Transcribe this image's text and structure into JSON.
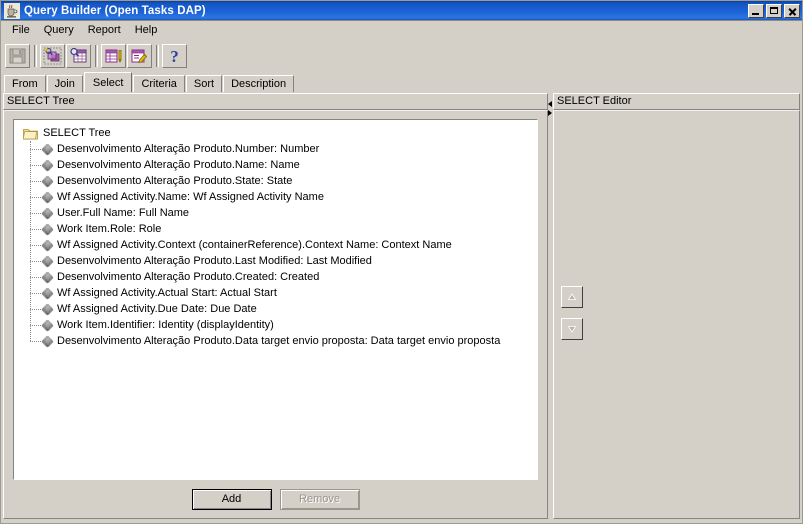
{
  "window": {
    "title": "Query Builder (Open Tasks DAP)",
    "app_icon": "java-coffee-cup-icon",
    "controls": {
      "minimize": "minimize-button",
      "maximize": "maximize-button",
      "close": "close-button"
    }
  },
  "menubar": {
    "items": [
      {
        "label": "File"
      },
      {
        "label": "Query"
      },
      {
        "label": "Report"
      },
      {
        "label": "Help"
      }
    ]
  },
  "toolbar": {
    "buttons": [
      {
        "icon": "save-icon",
        "tooltip": "Save",
        "enabled": false
      },
      {
        "icon": "new-query-icon",
        "tooltip": "New Query",
        "enabled": true
      },
      {
        "icon": "find-table-icon",
        "tooltip": "Find Table",
        "enabled": true
      },
      {
        "icon": "edit-report-icon",
        "tooltip": "Edit Report",
        "enabled": true
      },
      {
        "icon": "edit-properties-icon",
        "tooltip": "Edit Properties",
        "enabled": true
      },
      {
        "icon": "help-question-icon",
        "tooltip": "Help",
        "enabled": true
      }
    ]
  },
  "tabs": {
    "active": "Select",
    "items": [
      {
        "label": "From"
      },
      {
        "label": "Join"
      },
      {
        "label": "Select"
      },
      {
        "label": "Criteria"
      },
      {
        "label": "Sort"
      },
      {
        "label": "Description"
      }
    ]
  },
  "left_panel": {
    "title": "SELECT Tree",
    "tree": {
      "root": {
        "label": "SELECT Tree",
        "icon": "folder-icon"
      },
      "nodes": [
        {
          "label": "Desenvolvimento Alteração Produto.Number: Number"
        },
        {
          "label": "Desenvolvimento Alteração Produto.Name: Name"
        },
        {
          "label": "Desenvolvimento Alteração Produto.State: State"
        },
        {
          "label": "Wf Assigned Activity.Name: Wf Assigned Activity Name"
        },
        {
          "label": "User.Full Name: Full Name"
        },
        {
          "label": "Work Item.Role: Role"
        },
        {
          "label": "Wf Assigned Activity.Context (containerReference).Context Name: Context Name"
        },
        {
          "label": "Desenvolvimento Alteração Produto.Last Modified: Last Modified"
        },
        {
          "label": "Desenvolvimento Alteração Produto.Created: Created"
        },
        {
          "label": "Wf Assigned Activity.Actual Start: Actual Start"
        },
        {
          "label": "Wf Assigned Activity.Due Date: Due Date"
        },
        {
          "label": "Work Item.Identifier: Identity (displayIdentity)"
        },
        {
          "label": "Desenvolvimento Alteração Produto.Data target envio proposta: Data target envio proposta"
        }
      ]
    },
    "buttons": [
      {
        "label": "Add",
        "enabled": true
      },
      {
        "label": "Remove",
        "enabled": false
      }
    ]
  },
  "move_buttons": [
    {
      "icon": "move-up-icon",
      "enabled": false
    },
    {
      "icon": "move-down-icon",
      "enabled": false
    }
  ],
  "right_panel": {
    "title": "SELECT Editor",
    "content": ""
  },
  "colors": {
    "titlebar_blue": "#1c62d6",
    "window_face": "#d4d0c8",
    "tree_background": "#ffffff",
    "icon_purple": "#9b2d9b",
    "icon_yellow": "#e8c000",
    "help_blue": "#2a3fa8",
    "disabled_text": "#9a968e"
  }
}
